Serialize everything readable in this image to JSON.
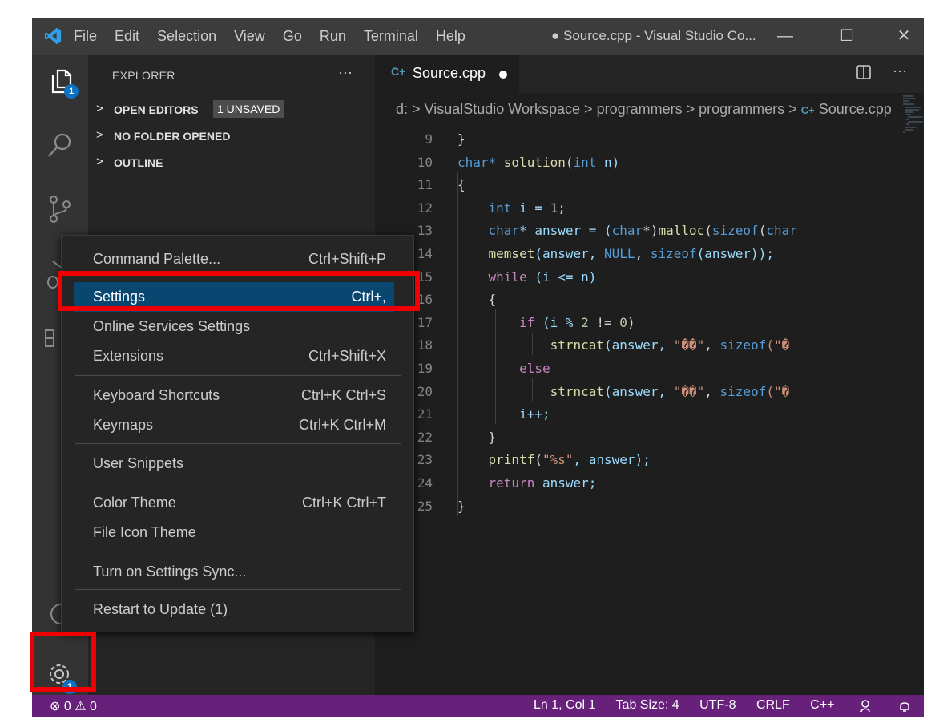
{
  "menubar": [
    "File",
    "Edit",
    "Selection",
    "View",
    "Go",
    "Run",
    "Terminal",
    "Help"
  ],
  "window_title": "● Source.cpp - Visual Studio Co...",
  "window_controls": {
    "minimize": "—",
    "maximize": "☐",
    "close": "✕"
  },
  "activity_bar": {
    "explorer_badge": "1",
    "manage_badge": "1"
  },
  "sidebar": {
    "title": "EXPLORER",
    "more": "···",
    "sections": [
      {
        "label": "OPEN EDITORS",
        "badge": "1 UNSAVED"
      },
      {
        "label": "NO FOLDER OPENED"
      },
      {
        "label": "OUTLINE"
      }
    ]
  },
  "tab": {
    "icon": "C+",
    "label": "Source.cpp"
  },
  "editor_actions": {
    "more": "···"
  },
  "breadcrumbs": {
    "items": [
      "d:",
      "VisualStudio Workspace",
      "programmers",
      "programmers"
    ],
    "file_icon": "C+",
    "file": "Source.cpp",
    "separator": ">"
  },
  "code_lines": [
    {
      "num": "9"
    },
    {
      "num": "10"
    },
    {
      "num": "11"
    },
    {
      "num": "12"
    },
    {
      "num": "13"
    },
    {
      "num": "14"
    },
    {
      "num": "15"
    },
    {
      "num": "16"
    },
    {
      "num": "17"
    },
    {
      "num": "18"
    },
    {
      "num": "19"
    },
    {
      "num": "20"
    },
    {
      "num": "21"
    },
    {
      "num": "22"
    },
    {
      "num": "23"
    },
    {
      "num": "24"
    },
    {
      "num": "25"
    }
  ],
  "code_text": {
    "l9": "}",
    "l10a": "char",
    "l10b": "* ",
    "l10c": "solution",
    "l10d": "(",
    "l10e": "int",
    "l10f": " n)",
    "l11": "{",
    "l12a": "int",
    "l12b": " i = ",
    "l12c": "1",
    "l12d": ";",
    "l13a": "char",
    "l13b": "* answer = (",
    "l13c": "char",
    "l13d": "*)",
    "l13e": "malloc",
    "l13f": "(",
    "l13g": "sizeof",
    "l13h": "(",
    "l13i": "char",
    "l14a": "memset",
    "l14b": "(answer, ",
    "l14c": "NULL",
    "l14d": ", ",
    "l14e": "sizeof",
    "l14f": "(answer));",
    "l15a": "while",
    "l15b": " (i <= n)",
    "l16": "{",
    "l17a": "if",
    "l17b": " (i % ",
    "l17c": "2",
    "l17d": " != ",
    "l17e": "0",
    "l17f": ")",
    "l18a": "strncat",
    "l18b": "(answer, ",
    "l18c": "\"��\"",
    "l18d": ", ",
    "l18e": "sizeof",
    "l18f": "(\"�",
    "l19": "else",
    "l20a": "strncat",
    "l20b": "(answer, ",
    "l20c": "\"��\"",
    "l20d": ", ",
    "l20e": "sizeof",
    "l20f": "(\"�",
    "l21": "i++;",
    "l22": "}",
    "l23a": "printf",
    "l23b": "(",
    "l23c": "\"%s\"",
    "l23d": ", answer);",
    "l24a": "return",
    "l24b": " answer;",
    "l25": "}"
  },
  "context_menu": {
    "items": [
      {
        "label": "Command Palette...",
        "shortcut": "Ctrl+Shift+P"
      },
      {
        "label": "Settings",
        "shortcut": "Ctrl+,"
      },
      {
        "label": "Online Services Settings",
        "shortcut": ""
      },
      {
        "label": "Extensions",
        "shortcut": "Ctrl+Shift+X"
      },
      {
        "label": "Keyboard Shortcuts",
        "shortcut": "Ctrl+K Ctrl+S"
      },
      {
        "label": "Keymaps",
        "shortcut": "Ctrl+K Ctrl+M"
      },
      {
        "label": "User Snippets",
        "shortcut": ""
      },
      {
        "label": "Color Theme",
        "shortcut": "Ctrl+K Ctrl+T"
      },
      {
        "label": "File Icon Theme",
        "shortcut": ""
      },
      {
        "label": "Turn on Settings Sync...",
        "shortcut": ""
      },
      {
        "label": "Restart to Update (1)",
        "shortcut": ""
      }
    ],
    "selected": "Settings"
  },
  "status_bar": {
    "problems": "⊗ 0 ⚠ 0",
    "position": "Ln 1, Col 1",
    "tab_size": "Tab Size: 4",
    "encoding": "UTF-8",
    "eol": "CRLF",
    "language": "C++"
  },
  "colors": {
    "status_bar": "#68217a",
    "selection": "#094771",
    "highlight_box": "#ee0000",
    "badge": "#0e70c0"
  }
}
